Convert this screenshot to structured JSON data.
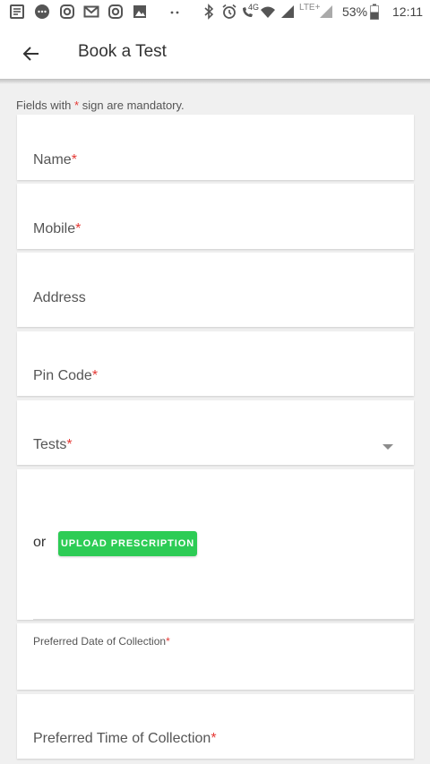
{
  "status_bar": {
    "icons": [
      "notes-icon",
      "message-icon",
      "instagram-icon",
      "gmail-icon",
      "instagram-icon",
      "image-icon",
      "more-dots-icon",
      "bluetooth-icon",
      "alarm-icon",
      "call-4g-icon",
      "wifi-icon",
      "signal-icon",
      "lte-signal-icon",
      "battery-icon"
    ],
    "call_network": "4G",
    "network": "LTE+",
    "battery": "53%",
    "time": "12:11"
  },
  "app_bar": {
    "back_icon": "arrow-left-icon",
    "title": "Book a Test"
  },
  "form": {
    "mandatory_note_prefix": "Fields with",
    "mandatory_star": "*",
    "mandatory_note_suffix": "sign are mandatory.",
    "required_mark": "*",
    "name_label": "Name",
    "mobile_label": "Mobile",
    "address_label": "Address",
    "pincode_label": "Pin Code",
    "tests_label": "Tests",
    "tests_dropdown_icon": "dropdown-arrow-icon",
    "or_text": "or",
    "upload_button": "UPLOAD PRESCRIPTION",
    "date_label": "Preferred Date of Collection",
    "time_label": "Preferred Time of Collection"
  },
  "colors": {
    "required": "#e53935",
    "upload_button": "#2dcc55",
    "background": "#f0f0f0"
  }
}
